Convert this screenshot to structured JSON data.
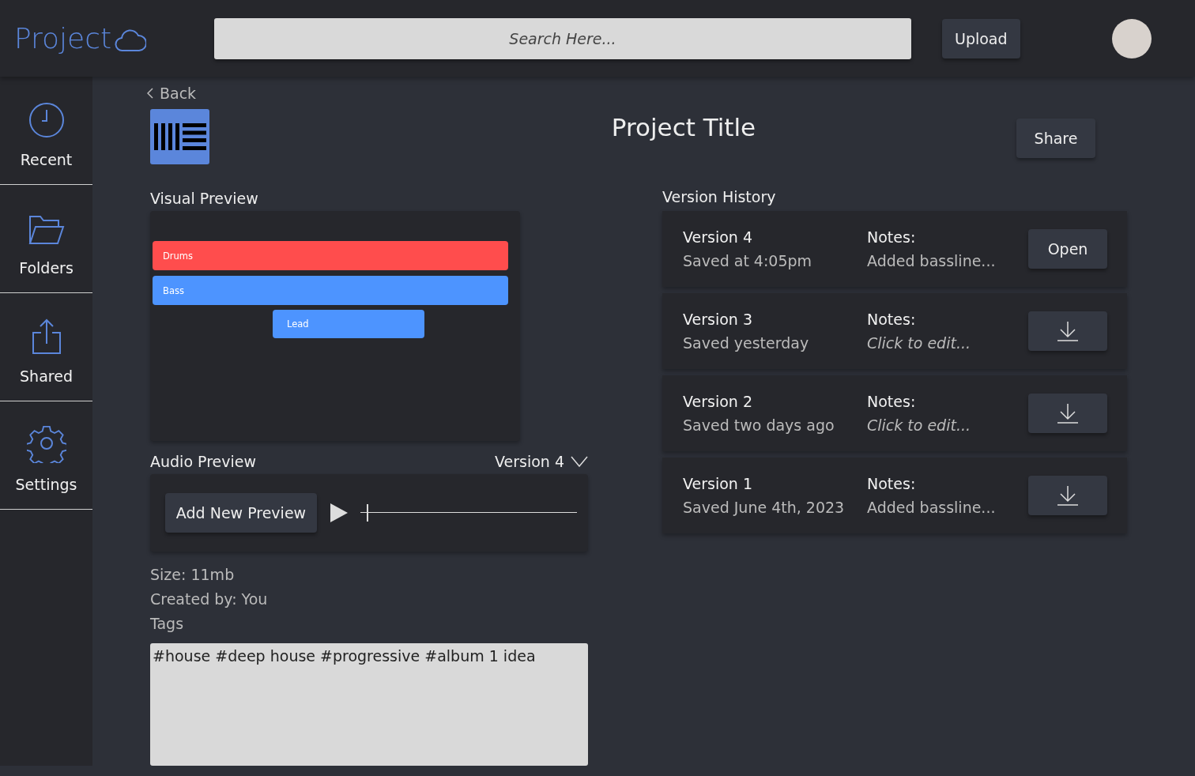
{
  "header": {
    "logo": "Project",
    "search": {
      "placeholder": "Search Here..."
    },
    "upload_button": "Upload"
  },
  "sidebar": {
    "items": [
      {
        "label": "Recent"
      },
      {
        "label": "Folders"
      },
      {
        "label": "Shared"
      },
      {
        "label": "Settings"
      }
    ]
  },
  "project": {
    "back": "Back",
    "title": "Project Title",
    "share_button": "Share"
  },
  "visual_preview": {
    "label": "Visual Preview",
    "tracks": [
      {
        "name": "Drums",
        "color": "#ff4d4d",
        "kind": "full"
      },
      {
        "name": "Bass",
        "color": "#4d94ff",
        "kind": "full"
      },
      {
        "name": "Lead",
        "color": "#4d94ff",
        "kind": "clip"
      }
    ]
  },
  "audio_preview": {
    "label": "Audio Preview",
    "version_select": "Version 4",
    "add_button": "Add New Preview",
    "level": 0.03
  },
  "details": {
    "size": "Size: 11mb",
    "created_by": "Created by: You",
    "tags_label": "Tags",
    "tags": "#house #deep house #progressive #album 1 idea"
  },
  "version_history": {
    "label": "Version History",
    "versions": [
      {
        "name": "Version 4",
        "saved": "Saved at 4:05pm",
        "notes_label": "Notes:",
        "notes": {
          "value": "Added bassline..."
        },
        "kind": "open",
        "button": "Open"
      },
      {
        "name": "Version 3",
        "saved": "Saved yesterday",
        "notes_label": "Notes:",
        "notes": {
          "placeholder": "Click to edit..."
        },
        "kind": "download"
      },
      {
        "name": "Version 2",
        "saved": "Saved two days ago",
        "notes_label": "Notes:",
        "notes": {
          "placeholder": "Click to edit..."
        },
        "kind": "download"
      },
      {
        "name": "Version 1",
        "saved": "Saved June 4th, 2023",
        "notes_label": "Notes:",
        "notes": {
          "value": "Added bassline..."
        },
        "kind": "download"
      }
    ]
  }
}
